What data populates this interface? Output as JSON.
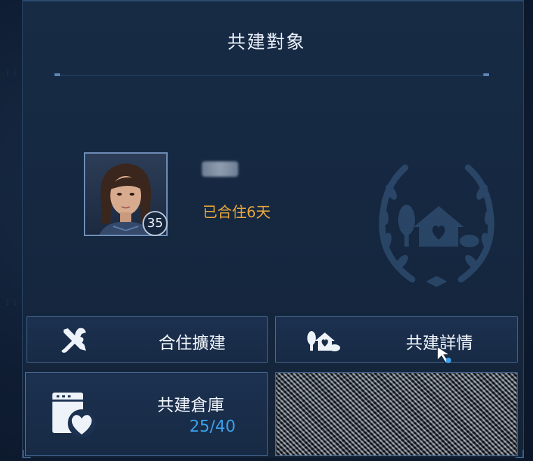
{
  "panel": {
    "title": "共建對象"
  },
  "partner": {
    "name": "",
    "level": "35",
    "cohabit_text": "已合住6天"
  },
  "actions": {
    "expand_label": "合住擴建",
    "detail_label": "共建詳情",
    "storage_label": "共建倉庫",
    "storage_count": "25/40"
  },
  "colors": {
    "accent_gold": "#e9a83a",
    "accent_blue": "#3aa0e8",
    "border": "#4a6d97",
    "background": "#15273f"
  },
  "icons": {
    "expand": "tools-icon",
    "detail": "house-detail-icon",
    "storage": "storage-heart-icon",
    "emblem": "laurel-house-heart-icon"
  }
}
